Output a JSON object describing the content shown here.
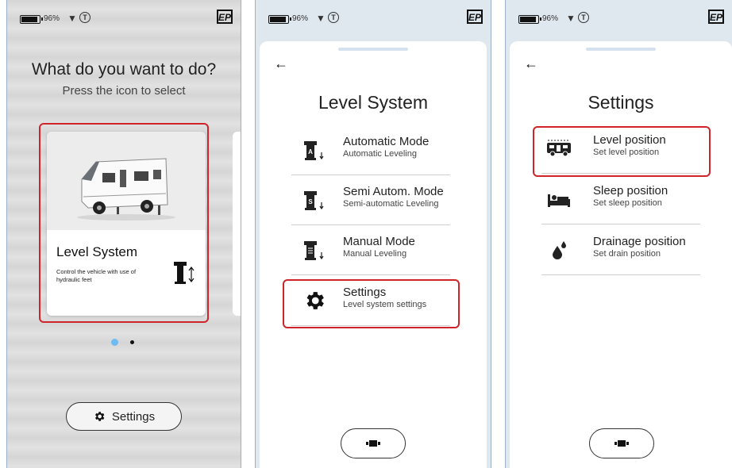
{
  "status": {
    "battery": "96%",
    "logo": "EP"
  },
  "screen1": {
    "title": "What do you want to do?",
    "subtitle": "Press the icon to select",
    "card": {
      "title": "Level System",
      "description": "Control the vehicle with use of hydraulic feet"
    },
    "carousel": {
      "active": 1,
      "count": 2
    },
    "settings_button": "Settings"
  },
  "screen2": {
    "back": "←",
    "title": "Level System",
    "items": [
      {
        "label": "Automatic Mode",
        "sub": "Automatic Leveling",
        "icon": "automatic-leveling-icon"
      },
      {
        "label": "Semi Autom. Mode",
        "sub": "Semi-automatic Leveling",
        "icon": "semi-auto-leveling-icon"
      },
      {
        "label": "Manual Mode",
        "sub": "Manual Leveling",
        "icon": "manual-leveling-icon"
      },
      {
        "label": "Settings",
        "sub": "Level system settings",
        "icon": "gear-icon"
      }
    ]
  },
  "screen3": {
    "back": "←",
    "title": "Settings",
    "items": [
      {
        "label": "Level position",
        "sub": "Set level position",
        "icon": "camper-icon"
      },
      {
        "label": "Sleep position",
        "sub": "Set sleep position",
        "icon": "bed-icon"
      },
      {
        "label": "Drainage position",
        "sub": "Set drain position",
        "icon": "drops-icon"
      }
    ]
  },
  "colors": {
    "highlight": "#d0242b",
    "active_dot": "#6dbbf0",
    "panel_bg": "#dfe7ef"
  }
}
